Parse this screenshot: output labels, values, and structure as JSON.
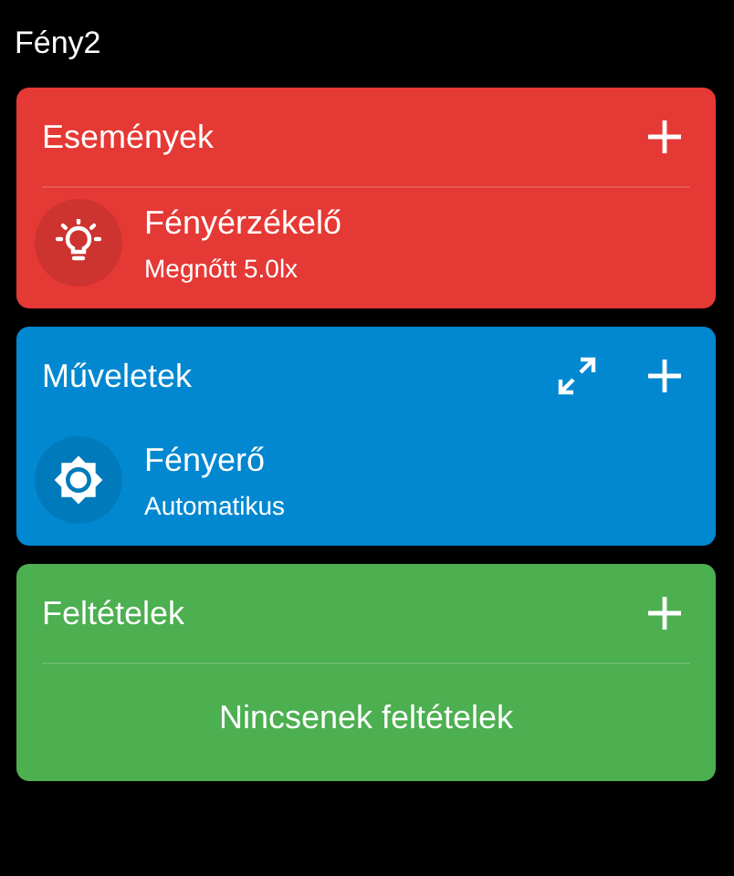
{
  "title": "Fény2",
  "sections": [
    {
      "title": "Események",
      "color": "#e53935",
      "expand_button": false,
      "divider": true,
      "items": [
        {
          "kind": "light",
          "name": "Fényérzékelő",
          "detail": "Megnőtt 5.0lx"
        }
      ]
    },
    {
      "title": "Műveletek",
      "color": "#0288d1",
      "expand_button": true,
      "divider": false,
      "items": [
        {
          "kind": "brightness",
          "name": "Fényerő",
          "detail": "Automatikus"
        }
      ]
    },
    {
      "title": "Feltételek",
      "color": "#4caf50",
      "expand_button": false,
      "divider": true,
      "empty_text": "Nincsenek feltételek"
    }
  ]
}
